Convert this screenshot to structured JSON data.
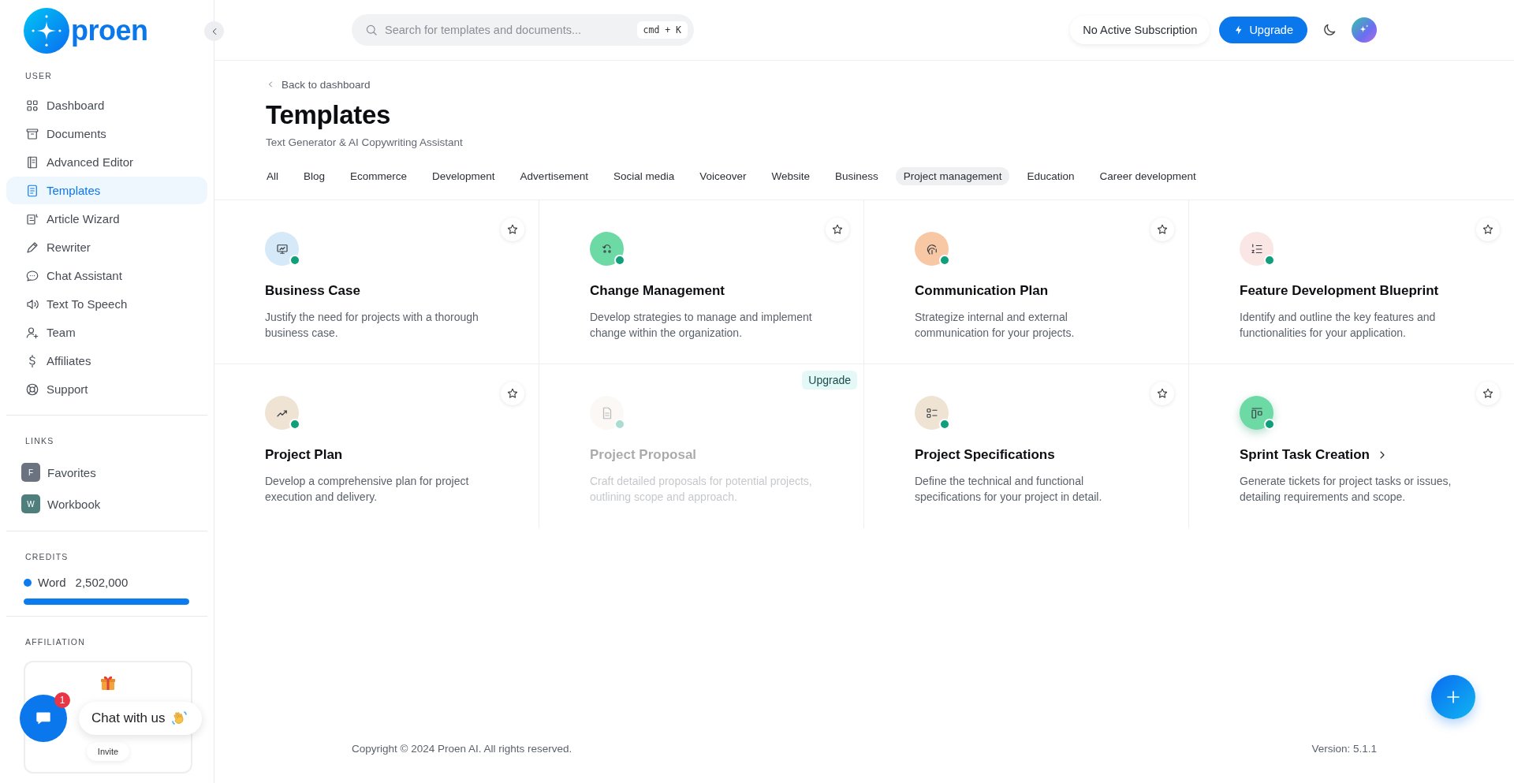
{
  "logo": {
    "text": "proen"
  },
  "sidebar": {
    "sections": [
      {
        "heading": "USER",
        "items": [
          {
            "label": "Dashboard",
            "selected": false
          },
          {
            "label": "Documents",
            "selected": false
          },
          {
            "label": "Advanced Editor",
            "selected": false
          },
          {
            "label": "Templates",
            "selected": true
          },
          {
            "label": "Article Wizard",
            "selected": false
          },
          {
            "label": "Rewriter",
            "selected": false
          },
          {
            "label": "Chat Assistant",
            "selected": false
          },
          {
            "label": "Text To Speech",
            "selected": false
          },
          {
            "label": "Team",
            "selected": false
          },
          {
            "label": "Affiliates",
            "selected": false
          },
          {
            "label": "Support",
            "selected": false
          }
        ]
      },
      {
        "heading": "LINKS",
        "links": [
          {
            "letter": "F",
            "label": "Favorites",
            "color": "#6b7280"
          },
          {
            "letter": "W",
            "label": "Workbook",
            "color": "#4f7f7d"
          }
        ]
      },
      {
        "heading": "CREDITS",
        "credit": {
          "label": "Word",
          "value": "2,502,000",
          "color": "#0a7cf0",
          "level": 1
        }
      },
      {
        "heading": "AFFILIATION",
        "affiliation": {
          "button": "Invite"
        }
      }
    ]
  },
  "topbar": {
    "search": {
      "placeholder": "Search for templates and documents...",
      "shortcut": "cmd + K"
    },
    "subscription": "No Active Subscription",
    "upgrade": "Upgrade"
  },
  "page": {
    "back": "Back to dashboard",
    "title": "Templates",
    "subtitle": "Text Generator & AI Copywriting Assistant",
    "tabs": [
      {
        "label": "All",
        "selected": false
      },
      {
        "label": "Blog",
        "selected": false
      },
      {
        "label": "Ecommerce",
        "selected": false
      },
      {
        "label": "Development",
        "selected": false
      },
      {
        "label": "Advertisement",
        "selected": false
      },
      {
        "label": "Social media",
        "selected": false
      },
      {
        "label": "Voiceover",
        "selected": false
      },
      {
        "label": "Website",
        "selected": false
      },
      {
        "label": "Business",
        "selected": false
      },
      {
        "label": "Project management",
        "selected": true
      },
      {
        "label": "Education",
        "selected": false
      },
      {
        "label": "Career development",
        "selected": false
      }
    ],
    "cards": [
      {
        "title": "Business Case",
        "description": "Justify the need for projects with a thorough business case.",
        "color": "#d6e9f8",
        "disabled": false,
        "hovered": false
      },
      {
        "title": "Change Management",
        "description": "Develop strategies to manage and implement change within the organization.",
        "color": "#6ddaa5",
        "disabled": false,
        "hovered": false
      },
      {
        "title": "Communication Plan",
        "description": "Strategize internal and external communication for your projects.",
        "color": "#f8c7a3",
        "disabled": false,
        "hovered": false
      },
      {
        "title": "Feature Development Blueprint",
        "description": "Identify and outline the key features and functionalities for your application.",
        "color": "#fbe6e6",
        "disabled": false,
        "hovered": false
      },
      {
        "title": "Project Plan",
        "description": "Develop a comprehensive plan for project execution and delivery.",
        "color": "#efe3d3",
        "disabled": false,
        "hovered": false
      },
      {
        "title": "Project Proposal",
        "description": "Craft detailed proposals for potential projects, outlining scope and approach.",
        "color": "#f4ede4",
        "disabled": true,
        "badge": "Upgrade",
        "hovered": false
      },
      {
        "title": "Project Specifications",
        "description": "Define the technical and functional specifications for your project in detail.",
        "color": "#efe3d3",
        "disabled": false,
        "hovered": false
      },
      {
        "title": "Sprint Task Creation",
        "description": "Generate tickets for project tasks or issues, detailing requirements and scope.",
        "color": "#6ddaa5",
        "disabled": false,
        "hovered": true
      }
    ]
  },
  "footer": {
    "copyright": "Copyright © 2024 Proen AI. All rights reserved.",
    "version": "Version: 5.1.1"
  },
  "chat": {
    "badge": "1",
    "label": "Chat with us"
  }
}
